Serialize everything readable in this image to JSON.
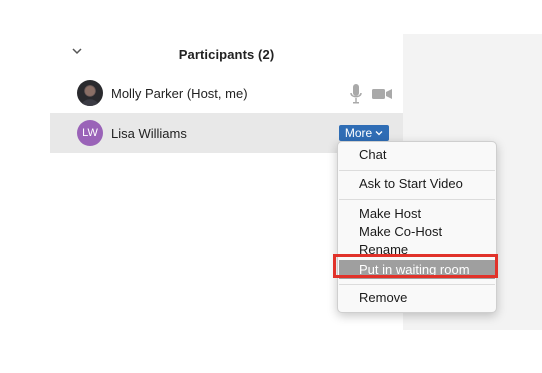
{
  "panel": {
    "title": "Participants (2)",
    "collapse_icon": "chevron-down-icon"
  },
  "participants": [
    {
      "name": "Molly Parker (Host, me)",
      "avatar": "photo",
      "mic_icon": "microphone-icon",
      "video_icon": "video-camera-icon"
    },
    {
      "name": "Lisa Williams",
      "avatar_initials": "LW",
      "avatar_color": "#9a63b8"
    }
  ],
  "more_button": {
    "label": "More",
    "icon": "chevron-down-icon",
    "color": "#2f6db5"
  },
  "menu": {
    "items": [
      {
        "label": "Chat"
      },
      {
        "label": "Ask to Start Video"
      },
      {
        "label": "Make Host"
      },
      {
        "label": "Make Co-Host"
      },
      {
        "label": "Rename"
      },
      {
        "label": "Put in waiting room",
        "highlighted": true
      },
      {
        "label": "Remove"
      }
    ]
  },
  "highlight_color": "#e1322a"
}
